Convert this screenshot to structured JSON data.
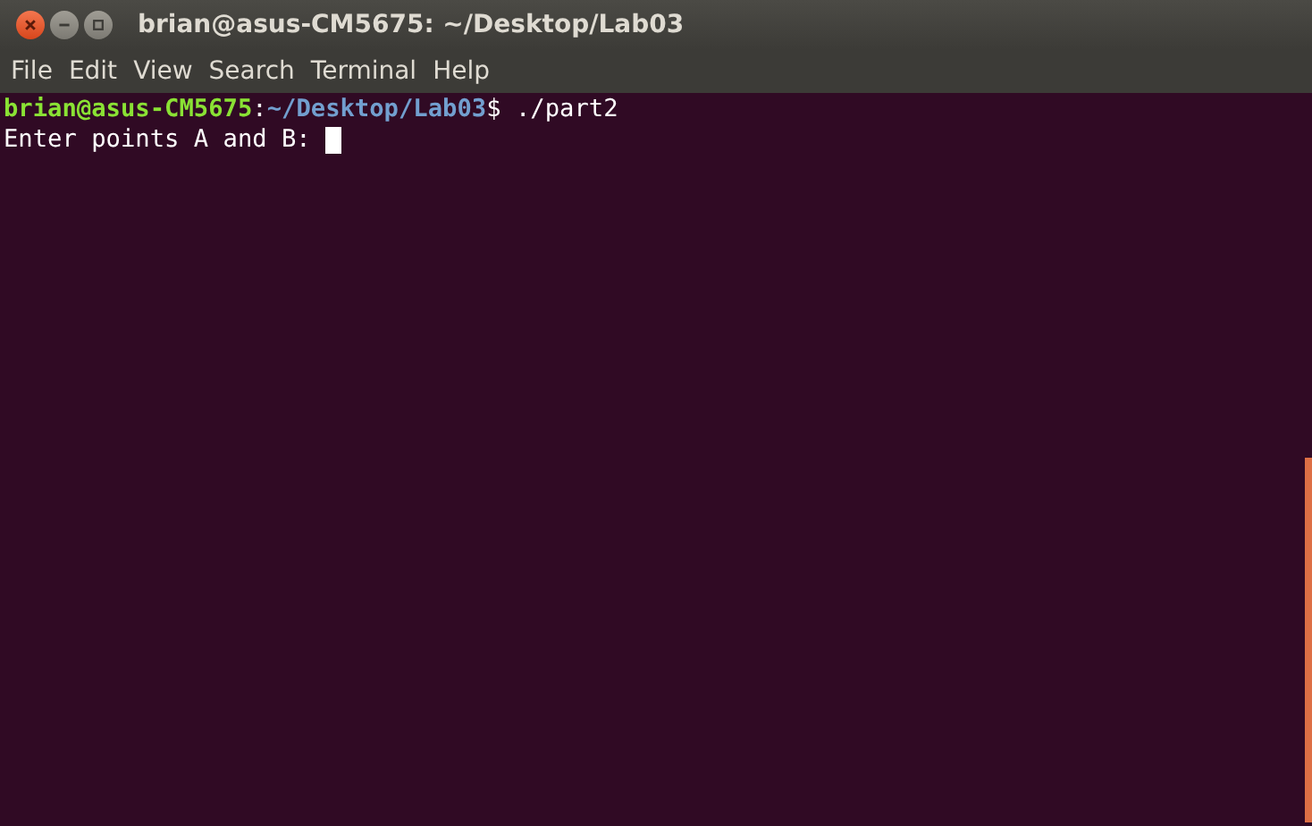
{
  "window": {
    "title": "brian@asus-CM5675: ~/Desktop/Lab03"
  },
  "menu": [
    "File",
    "Edit",
    "View",
    "Search",
    "Terminal",
    "Help"
  ],
  "terminal": {
    "lines": [
      {
        "segments": [
          {
            "kind": "user",
            "text": "brian@asus-CM5675"
          },
          {
            "kind": "plain",
            "text": ":"
          },
          {
            "kind": "path",
            "text": "~/Desktop/Lab03"
          },
          {
            "kind": "plain",
            "text": "$ ./part2"
          }
        ],
        "cursor": false
      },
      {
        "segments": [
          {
            "kind": "plain",
            "text": "Enter points A and B: "
          }
        ],
        "cursor": true
      }
    ]
  }
}
